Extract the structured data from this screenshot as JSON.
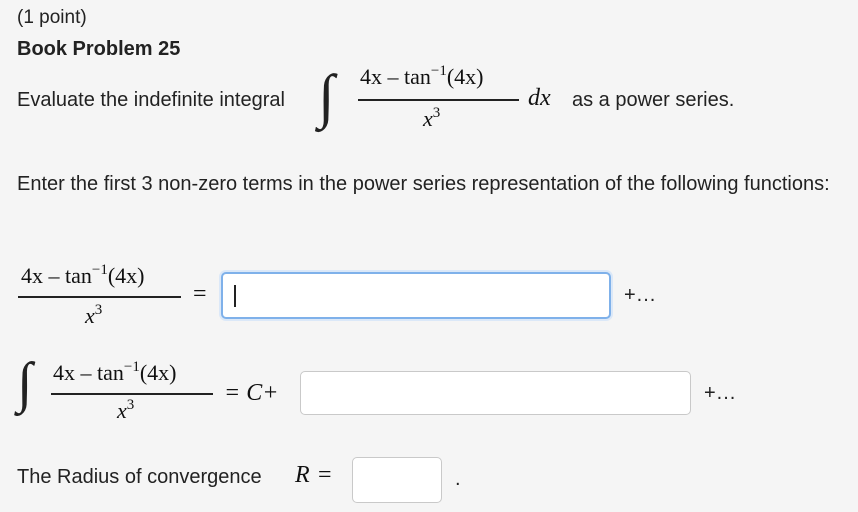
{
  "header": {
    "points": "(1 point)",
    "problem_title": "Book Problem 25"
  },
  "prompt": {
    "evaluate_text": "Evaluate the indefinite integral",
    "power_series_text": "as a power series.",
    "dx": "dx",
    "instructions": "Enter the first 3 non-zero terms in the power series representation of the following functions:"
  },
  "expression": {
    "numerator_main": "4x – tan",
    "numerator_exp": "−1",
    "numerator_tail": "(4x)",
    "denominator_base": "x",
    "denominator_exp": "3"
  },
  "answers": {
    "row1_equals": "=",
    "row1_value": "",
    "row1_suffix": "+...",
    "row2_equals": "= C+",
    "row2_value": "",
    "row2_suffix": "+...",
    "radius_label": "The Radius of convergence",
    "radius_var": "R",
    "radius_equals": "=",
    "radius_value": "",
    "radius_period": "."
  }
}
